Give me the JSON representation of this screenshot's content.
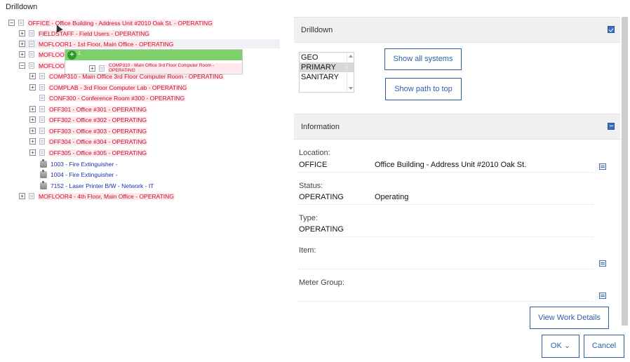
{
  "dialog": {
    "title": "Drilldown"
  },
  "tree": {
    "nodes": [
      {
        "label": "OFFICE - Office Building - Address Unit #2010 Oak St. - OPERATING"
      },
      {
        "label": "FIELDSTAFF - Field Users - OPERATING"
      },
      {
        "label": "MOFLOOR1 - 1st Floor, Main Office - OPERATING"
      },
      {
        "label": "MOFLOOI"
      },
      {
        "label": "MOFLOOI"
      },
      {
        "label": "COMP310 - Main Office 3rd Floor Computer Room - OPERATING"
      },
      {
        "label": "COMPLAB - 3rd Floor Computer Lab - OPERATING"
      },
      {
        "label": "CONF300 - Conference Room #300 - OPERATING"
      },
      {
        "label": "OFF301 - Office #301 - OPERATING"
      },
      {
        "label": "OFF302 - Office #302 - OPERATING"
      },
      {
        "label": "OFF303 - Office #303 - OPERATING"
      },
      {
        "label": "OFF304 - Office #304 - OPERATING"
      },
      {
        "label": "OFF305 - Office #305 - OPERATING"
      },
      {
        "label": "1003 - Fire Extinguisher -"
      },
      {
        "label": "1004 - Fire Extinguisher -"
      },
      {
        "label": "7152 - Laser Printer B/W - Network - IT"
      },
      {
        "label": "MOFLOOR4 - 4th Floor, Main Office - OPERATING"
      }
    ],
    "drag": {
      "count": "1",
      "label": "COMP310 - Main Office 3rd Floor Computer Room - OPERATING"
    }
  },
  "drilldown": {
    "header": "Drilldown",
    "options": [
      "GEO",
      "PRIMARY",
      "SANITARY"
    ],
    "selected": "PRIMARY",
    "show_all_label": "Show all systems",
    "show_path_label": "Show path to top"
  },
  "information": {
    "header": "Information",
    "location_label": "Location:",
    "location_value": "OFFICE",
    "location_desc": "Office Building - Address Unit #2010 Oak St.",
    "status_label": "Status:",
    "status_value": "OPERATING",
    "status_desc": "Operating",
    "type_label": "Type:",
    "type_value": "OPERATING",
    "item_label": "Item:",
    "meter_label": "Meter Group:",
    "view_work_label": "View Work Details"
  },
  "footer": {
    "ok_label": "OK",
    "ok_chevron": "⌄",
    "cancel_label": "Cancel"
  },
  "icons": {
    "toggle_plus": "+",
    "toggle_minus": "−"
  }
}
